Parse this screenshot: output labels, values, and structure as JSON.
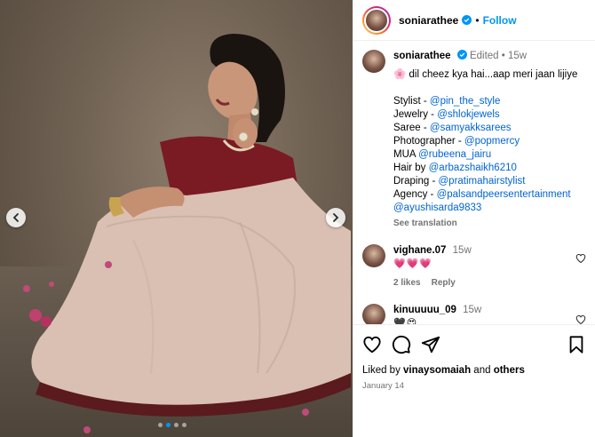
{
  "post": {
    "author": {
      "username": "soniarathee",
      "verified": true,
      "follow_label": "Follow",
      "separator": "•"
    },
    "caption": {
      "username": "soniarathee",
      "edited_label": "Edited",
      "dot": "•",
      "time": "15w",
      "text": "🌸 dil cheez kya hai...aap meri jaan lijiye",
      "credits": [
        {
          "label": "Stylist - ",
          "mention": "@pin_the_style"
        },
        {
          "label": "Jewelry - ",
          "mention": "@shlokjewels"
        },
        {
          "label": "Saree - ",
          "mention": "@samyakksarees"
        },
        {
          "label": "Photographer - ",
          "mention": "@popmercy"
        },
        {
          "label": "MUA ",
          "mention": "@rubeena_jairu"
        },
        {
          "label": "Hair by ",
          "mention": "@arbazshaikh6210"
        },
        {
          "label": "Draping - ",
          "mention": "@pratimahairstylist"
        },
        {
          "label": "Agency - ",
          "mention": "@palsandpeersentertainment"
        },
        {
          "label": "",
          "mention": "@ayushisarda9833"
        }
      ],
      "see_translation": "See translation"
    },
    "comments": [
      {
        "username": "vighane.07",
        "time": "15w",
        "text": "💗💗💗",
        "likes": "2 likes",
        "reply": "Reply"
      },
      {
        "username": "kinuuuuu_09",
        "time": "15w",
        "text": "🖤😍"
      }
    ],
    "footer": {
      "liked_by_prefix": "Liked by ",
      "liked_by_user": "vinaysomaiah",
      "liked_by_and": " and ",
      "liked_by_others": "others",
      "date": "January 14"
    },
    "carousel": {
      "total": 4,
      "active": 1
    }
  },
  "colors": {
    "link": "#0064d1",
    "follow": "#0095f6",
    "muted": "#737373",
    "verified": "#0095f6"
  }
}
